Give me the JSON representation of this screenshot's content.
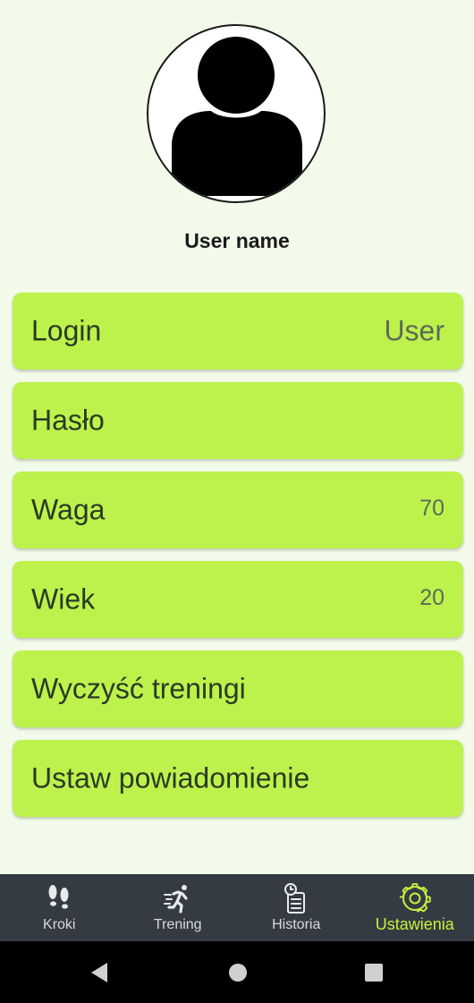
{
  "profile": {
    "username": "User name"
  },
  "settings": [
    {
      "label": "Login",
      "value": "User",
      "value_style": "big"
    },
    {
      "label": "Hasło",
      "value": "",
      "value_style": "small"
    },
    {
      "label": "Waga",
      "value": "70",
      "value_style": "small"
    },
    {
      "label": "Wiek",
      "value": "20",
      "value_style": "small"
    },
    {
      "label": "Wyczyść treningi",
      "value": "",
      "value_style": "small"
    },
    {
      "label": "Ustaw powiadomienie",
      "value": "",
      "value_style": "small"
    }
  ],
  "bottom_nav": {
    "items": [
      {
        "label": "Kroki",
        "icon": "footsteps-icon",
        "active": false
      },
      {
        "label": "Trening",
        "icon": "running-icon",
        "active": false
      },
      {
        "label": "Historia",
        "icon": "history-icon",
        "active": false
      },
      {
        "label": "Ustawienia",
        "icon": "gear-icon",
        "active": true
      }
    ]
  },
  "system_nav": {
    "buttons": [
      "back-icon",
      "home-icon",
      "recents-icon"
    ]
  },
  "colors": {
    "background": "#f2fbe9",
    "card": "#bdf24c",
    "nav_bar": "#353b42",
    "nav_active": "#c3f23e"
  }
}
